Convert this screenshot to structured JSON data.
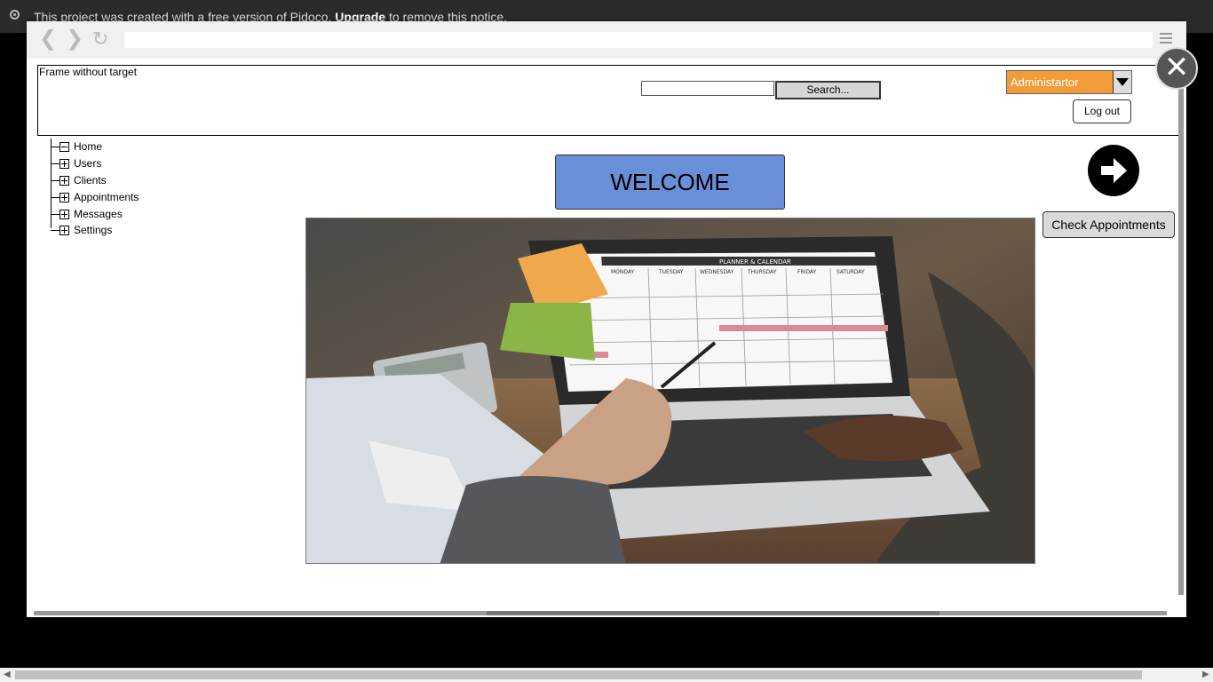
{
  "notice": {
    "prefix": "This project was created with a free version of Pidoco.",
    "link": "Upgrade",
    "suffix": "to remove this notice."
  },
  "frame": {
    "label": "Frame without target"
  },
  "search": {
    "button_label": "Search...",
    "value": ""
  },
  "role_select": {
    "value": "Administartor"
  },
  "logout_label": "Log out",
  "tree": {
    "items": [
      {
        "label": "Home",
        "expanded": true
      },
      {
        "label": "Users",
        "expanded": false
      },
      {
        "label": "Clients",
        "expanded": false
      },
      {
        "label": "Appointments",
        "expanded": false
      },
      {
        "label": "Messages",
        "expanded": false
      },
      {
        "label": "Settings",
        "expanded": false
      }
    ]
  },
  "welcome_label": "WELCOME",
  "check_appointments_label": "Check Appointments",
  "photo": {
    "calendar_title": "PLANNER & CALENDAR",
    "days": [
      "MONDAY",
      "TUESDAY",
      "WEDNESDAY",
      "THURSDAY",
      "FRIDAY",
      "SATURDAY"
    ]
  },
  "colors": {
    "accent_orange": "#f19c38",
    "welcome_blue": "#6a8fd9",
    "notice_bg": "#2b2b2b"
  }
}
